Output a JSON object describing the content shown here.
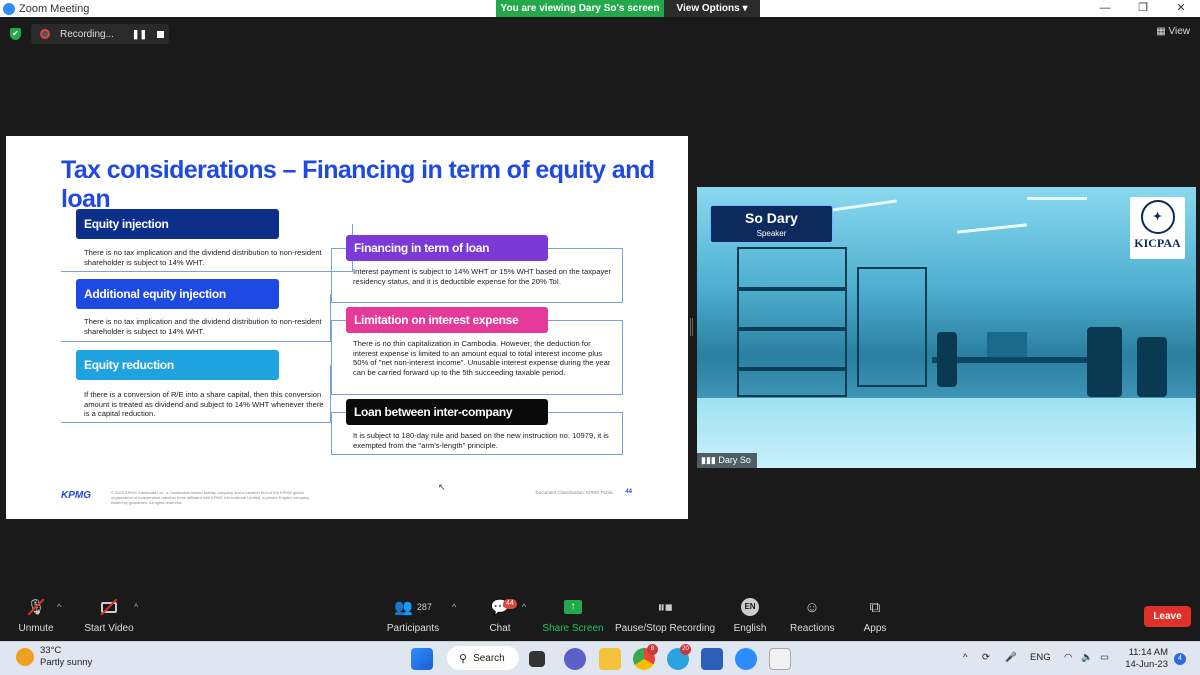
{
  "window": {
    "title": "Zoom Meeting",
    "minimize": "—",
    "maximize": "❐",
    "close": "✕"
  },
  "banner": {
    "viewing_text": "You are viewing Dary So's screen",
    "view_options": "View Options ▾"
  },
  "recording": {
    "label": "Recording..."
  },
  "view_button": {
    "label": "View"
  },
  "slide": {
    "title": "Tax considerations – Financing in term of equity and loan",
    "left_items": [
      {
        "heading": "Equity injection",
        "color": "#0c2f8a",
        "text": "There is no tax implication and the dividend distribution to non-resident shareholder is subject to 14% WHT."
      },
      {
        "heading": "Additional equity injection",
        "color": "#1e49e2",
        "text": "There is no tax implication and the dividend distribution to non-resident shareholder is subject to 14% WHT."
      },
      {
        "heading": "Equity reduction",
        "color": "#1ea3e0",
        "text": "If there is a conversion of R/E into a share capital, then this conversion amount is treated as dividend and subject to 14% WHT whenever there is a capital reduction."
      }
    ],
    "right_items": [
      {
        "heading": "Financing in term of loan",
        "color": "#7b3ad8",
        "text": "Interest payment is subject to 14% WHT or 15% WHT based on the taxpayer residency status, and it is deductible expense for the 20% ToI."
      },
      {
        "heading": "Limitation on interest expense",
        "color": "#e53a9a",
        "text": "There is no thin capitalization in Cambodia. However, the deduction for interest expense is limited to an amount equal to total interest income plus 50% of \"net non-interest income\". Unusable interest expense during the year can be carried forward up to the 5th succeeding taxable period."
      },
      {
        "heading": "Loan between inter-company",
        "color": "#0a0a0a",
        "text": "It is subject to 180-day rule and based on the new instruction no. 10979, it is exempted from the \"arm's-length\" principle."
      }
    ],
    "logo": "KPMG",
    "footer_legal": "© 2023 KPMG Cambodia Ltd., a Cambodian limited liability company and a member firm of the KPMG global organization of independent member firms affiliated with KPMG International Limited, a private English company limited by guarantee. All rights reserved.",
    "doc_class": "Document Classification: KPMG Public",
    "page_number": "44"
  },
  "speaker": {
    "name": "So Dary",
    "role": "Speaker",
    "org_logo": "KICPAA",
    "label": "Dary So"
  },
  "controls": {
    "unmute": "Unmute",
    "start_video": "Start Video",
    "participants": "Participants",
    "participants_count": "287",
    "chat": "Chat",
    "chat_badge": "44",
    "share_screen": "Share Screen",
    "pause_recording": "Pause/Stop Recording",
    "language": "English",
    "language_code": "EN",
    "reactions": "Reactions",
    "apps": "Apps",
    "leave": "Leave"
  },
  "taskbar": {
    "temperature": "33°C",
    "weather": "Partly sunny",
    "search": "Search",
    "language": "ENG",
    "time": "11:14 AM",
    "date": "14-Jun-23",
    "notifications": "4",
    "chrome_badge": "8",
    "telegram_badge": "20"
  }
}
